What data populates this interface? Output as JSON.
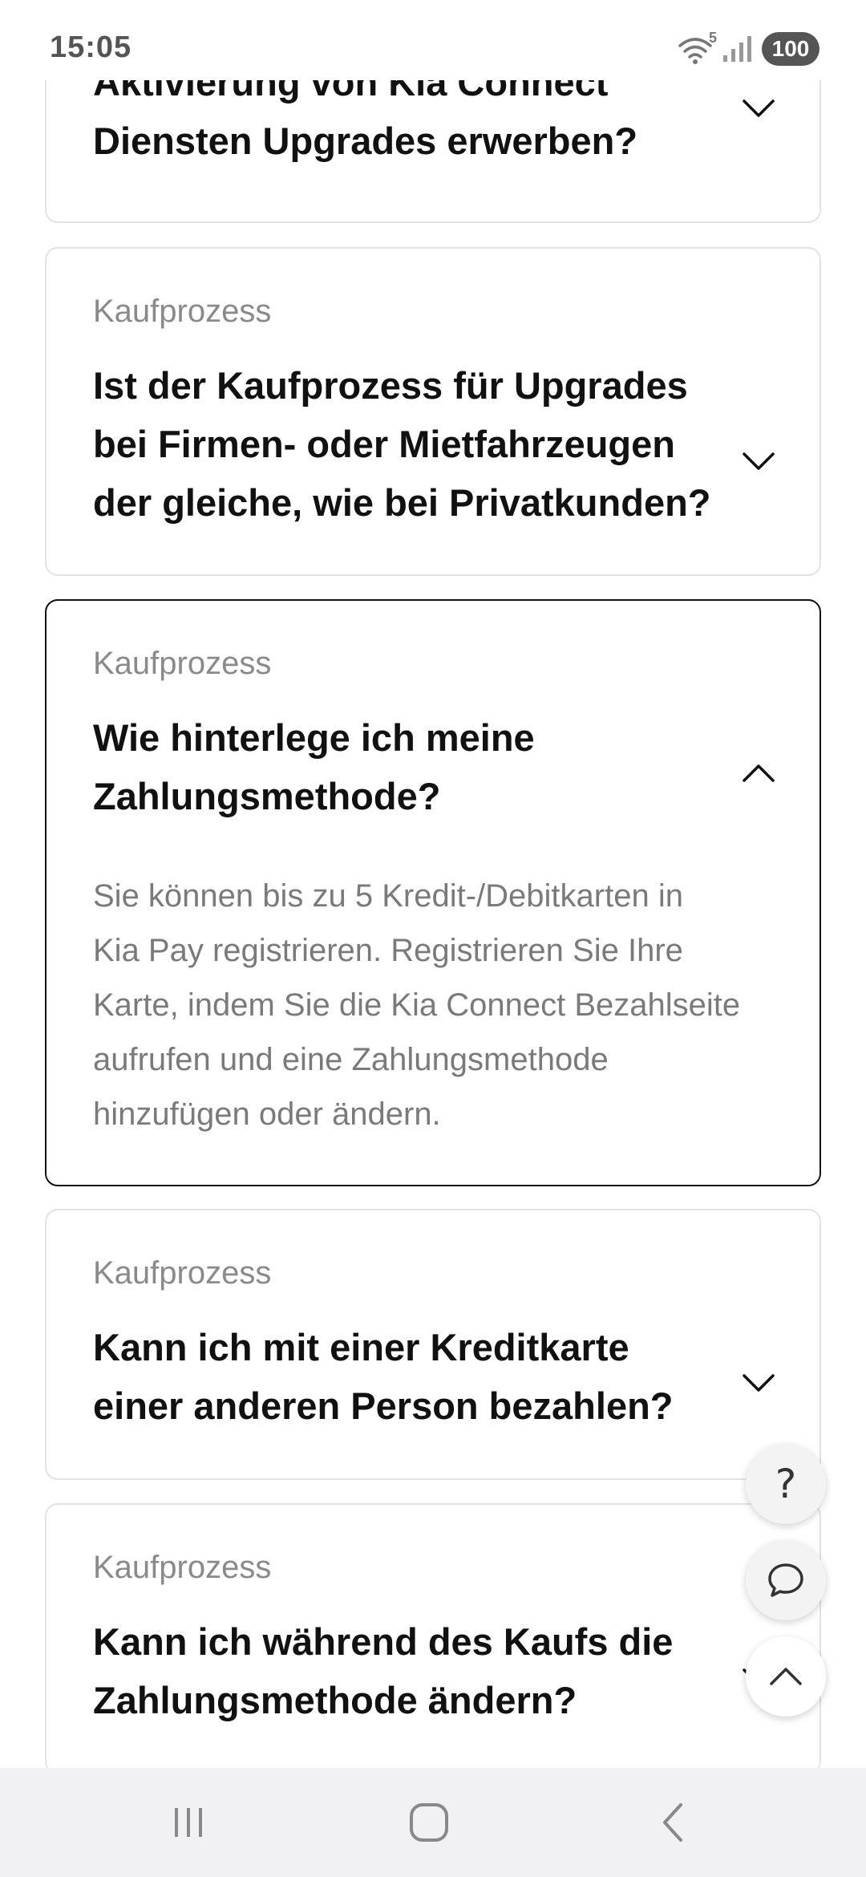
{
  "status_bar": {
    "time": "15:05",
    "wifi_badge": "5",
    "battery": "100"
  },
  "faq": {
    "items": [
      {
        "category": "",
        "question_lines": [
          "Aktivierung von Kia Connect",
          "Diensten Upgrades erwerben?"
        ],
        "expanded": false
      },
      {
        "category": "Kaufprozess",
        "question_lines": [
          "Ist der Kaufprozess für Upgrades",
          "bei Firmen- oder Mietfahrzeugen",
          "der gleiche, wie bei Privatkunden?"
        ],
        "expanded": false
      },
      {
        "category": "Kaufprozess",
        "question_lines": [
          "Wie hinterlege ich meine",
          "Zahlungsmethode?"
        ],
        "expanded": true,
        "answer_lines": [
          "Sie können bis zu 5 Kredit-/Debitkarten in",
          "Kia Pay registrieren. Registrieren Sie Ihre",
          "Karte, indem Sie die Kia Connect Bezahlseite",
          "aufrufen und eine Zahlungsmethode",
          "hinzufügen oder ändern."
        ]
      },
      {
        "category": "Kaufprozess",
        "question_lines": [
          "Kann ich mit einer Kreditkarte",
          "einer anderen Person bezahlen?"
        ],
        "expanded": false
      },
      {
        "category": "Kaufprozess",
        "question_lines": [
          "Kann ich während des Kaufs die",
          "Zahlungsmethode ändern?"
        ],
        "expanded": false
      }
    ]
  },
  "floating_actions": {
    "help_label": "?",
    "chat_icon": "chat-bubble-icon",
    "scroll_top_icon": "chevron-up-icon"
  },
  "nav_bar": {
    "recents_icon": "recents-icon",
    "home_icon": "home-icon",
    "back_icon": "back-icon"
  }
}
